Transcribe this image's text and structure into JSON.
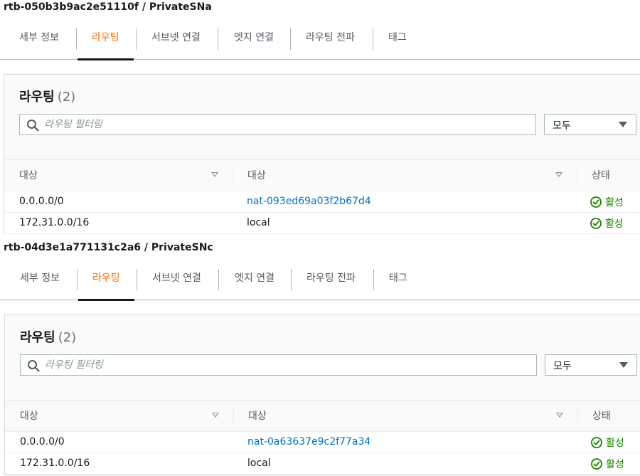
{
  "route_tables": [
    {
      "title": "rtb-050b3b9ac2e51110f / PrivateSNa",
      "tabs": [
        "세부 정보",
        "라우팅",
        "서브넷 연결",
        "엣지 연결",
        "라우팅 전파",
        "태그"
      ],
      "active_tab": "라우팅",
      "panel": {
        "title": "라우팅",
        "count": "(2)",
        "search_placeholder": "라우팅 필터링",
        "filter_value": "모두",
        "columns": [
          "대상",
          "대상",
          "상태"
        ],
        "rows": [
          {
            "destination": "0.0.0.0/0",
            "target": "nat-093ed69a03f2b67d4",
            "status": "활성"
          },
          {
            "destination": "172.31.0.0/16",
            "target": "local",
            "status": "활성"
          }
        ]
      }
    },
    {
      "title": "rtb-04d3e1a771131c2a6 / PrivateSNc",
      "tabs": [
        "세부 정보",
        "라우팅",
        "서브넷 연결",
        "엣지 연결",
        "라우팅 전파",
        "태그"
      ],
      "active_tab": "라우팅",
      "panel": {
        "title": "라우팅",
        "count": "(2)",
        "search_placeholder": "라우팅 필터링",
        "filter_value": "모두",
        "columns": [
          "대상",
          "대상",
          "상태"
        ],
        "rows": [
          {
            "destination": "0.0.0.0/0",
            "target": "nat-0a63637e9c2f77a34",
            "status": "활성"
          },
          {
            "destination": "172.31.0.0/16",
            "target": "local",
            "status": "활성"
          }
        ]
      }
    }
  ],
  "colors": {
    "accent_active_tab": "#ec7211",
    "link": "#0073bb",
    "status_active": "#1d8102"
  },
  "icons": {
    "search": "search-icon",
    "caret": "caret-down-icon",
    "sort": "sort-icon",
    "status": "check-circle-icon"
  }
}
